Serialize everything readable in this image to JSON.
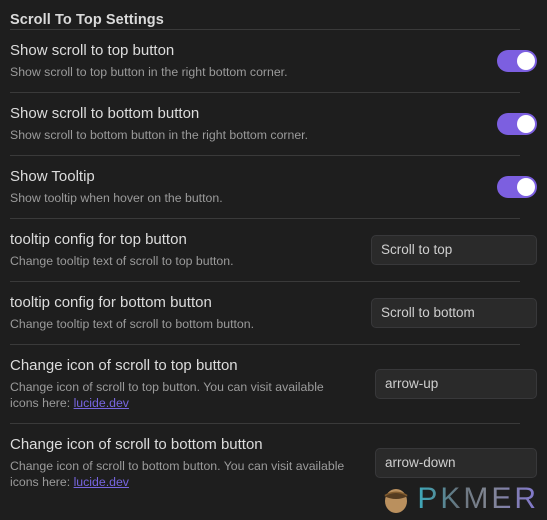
{
  "heading": "Scroll To Top Settings",
  "settings": [
    {
      "key": "show-scroll-to-top-button",
      "name": "Show scroll to top button",
      "desc": "Show scroll to top button in the right bottom corner.",
      "control": "toggle",
      "value": "on"
    },
    {
      "key": "show-scroll-to-bottom-button",
      "name": "Show scroll to bottom button",
      "desc": "Show scroll to bottom button in the right bottom corner.",
      "control": "toggle",
      "value": "on"
    },
    {
      "key": "show-tooltip",
      "name": "Show Tooltip",
      "desc": "Show tooltip when hover on the button.",
      "control": "toggle",
      "value": "on"
    },
    {
      "key": "tooltip-config-top",
      "name": "tooltip config for top button",
      "desc": "Change tooltip text of scroll to top button.",
      "control": "text",
      "value": "Scroll to top",
      "placeholder": "Scroll to top"
    },
    {
      "key": "tooltip-config-bottom",
      "name": "tooltip config for bottom button",
      "desc": "Change tooltip text of scroll to bottom button.",
      "control": "text",
      "value": "Scroll to bottom",
      "placeholder": "Scroll to bottom"
    },
    {
      "key": "change-icon-top",
      "name": "Change icon of scroll to top button",
      "desc_before_link": "Change icon of scroll to top button. You can visit available icons here: ",
      "link_text": "lucide.dev",
      "control": "text",
      "value": "arrow-up",
      "placeholder": "arrow-up"
    },
    {
      "key": "change-icon-bottom",
      "name": "Change icon of scroll to bottom button",
      "desc_before_link": "Change icon of scroll to bottom button. You can visit available icons here: ",
      "link_text": "lucide.dev",
      "control": "text",
      "value": "arrow-down",
      "placeholder": "arrow-down"
    }
  ],
  "watermark": {
    "text": "PKMER",
    "mark": "pkmer-logo-icon"
  },
  "colors": {
    "background": "#1e1e1e",
    "toggle_on": "#7c5fe0",
    "link": "#7765e0",
    "text": "#dcdcdc",
    "muted_text": "#9b9b9b",
    "input_background": "#2a2a2a",
    "divider": "#3a3a3a"
  }
}
